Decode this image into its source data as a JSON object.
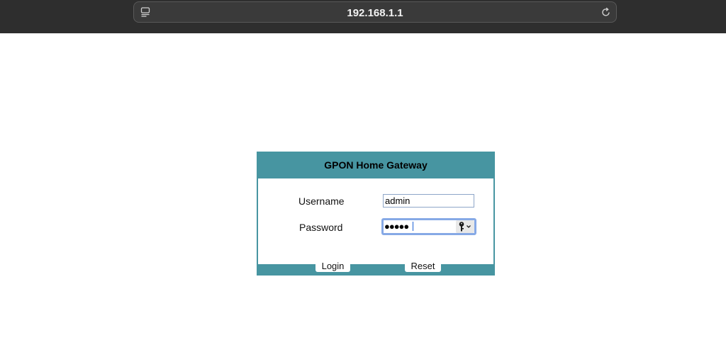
{
  "browser": {
    "url": "192.168.1.1",
    "icons": [
      "page-icon",
      "reload-icon"
    ]
  },
  "login": {
    "title": "GPON Home Gateway",
    "username_label": "Username",
    "username_value": "admin",
    "password_label": "Password",
    "password_masked": "●●●●●",
    "login_label": "Login",
    "reset_label": "Reset",
    "key_icon": "key-icon"
  },
  "colors": {
    "panel_accent": "#4795a1",
    "toolbar_bg": "#2e2e2e",
    "focus_ring": "#86a9e6"
  }
}
